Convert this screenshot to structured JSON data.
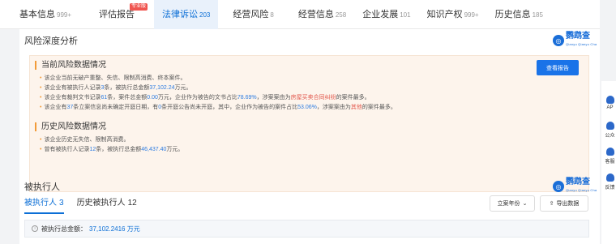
{
  "tabs": [
    {
      "label": "基本信息",
      "count": "999+"
    },
    {
      "label": "评估报告",
      "count": "",
      "badge": "专业版"
    },
    {
      "label": "法律诉讼",
      "count": "203"
    },
    {
      "label": "经营风险",
      "count": "8"
    },
    {
      "label": "经营信息",
      "count": "258"
    },
    {
      "label": "企业发展",
      "count": "101"
    },
    {
      "label": "知识产权",
      "count": "999+"
    },
    {
      "label": "历史信息",
      "count": "185"
    }
  ],
  "risk_section": {
    "title": "风险深度分析",
    "logo_text": "鹦鹉查",
    "logo_sub": "Qianyu Qianyu Cha",
    "report_button": "查看报告",
    "current": {
      "heading": "当前风险数据情况",
      "l1": "该企业当前无破产重整、失信、限制高消费、终本案件。",
      "l2_a": "该企业有被执行人记录",
      "l2_b": "3",
      "l2_c": "条，被执行总金额",
      "l2_d": "37,102.24",
      "l2_e": "万元。",
      "l3_a": "该企业有裁判文书记录",
      "l3_b": "61",
      "l3_c": "条，案件总金额",
      "l3_d": "0.00",
      "l3_e": "万元，企业作为被告的文书占比",
      "l3_f": "78.69%",
      "l3_g": "，涉案案由为",
      "l3_h": "房屋买卖合同纠纷",
      "l3_i": "的案件最多。",
      "l4_a": "该企业有",
      "l4_b": "37",
      "l4_c": "条立案信息尚未确定开庭日期，有",
      "l4_d": "0",
      "l4_e": "条开庭公告尚未开庭，其中，企业作为被告的案件占比",
      "l4_f": "53.06%",
      "l4_g": "，涉案案由为",
      "l4_h": "其他",
      "l4_i": "的案件最多。"
    },
    "history": {
      "heading": "历史风险数据情况",
      "l1": "该企业历史无失信、限制高消费。",
      "l2_a": "曾有被执行人记录",
      "l2_b": "12",
      "l2_c": "条，被执行总金额",
      "l2_d": "46,437.40",
      "l2_e": "万元。"
    }
  },
  "executed": {
    "title": "被执行人",
    "logo_text": "鹦鹉查",
    "logo_sub": "Qianyu Qianyu Cha",
    "subtabs": [
      {
        "label": "被执行人",
        "count": "3"
      },
      {
        "label": "历史被执行人",
        "count": "12"
      }
    ],
    "filter_label": "立案年份",
    "export_label": "导出数据",
    "summary_label": "被执行总金额：",
    "summary_value": "37,102.2416 万元"
  },
  "right_sidebar": {
    "items": [
      "AP",
      "公众",
      "客服",
      "反馈"
    ]
  }
}
